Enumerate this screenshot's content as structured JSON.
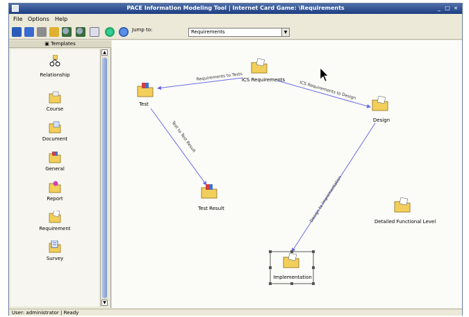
{
  "window": {
    "title": "PACE Information Modeling Tool | Internet Card Game: \\Requirements",
    "controls": [
      "_",
      "□",
      "×"
    ]
  },
  "menu": [
    "File",
    "Options",
    "Help"
  ],
  "toolbar": {
    "jump_label": "Jump to:",
    "jump_value": "Requirements",
    "icons": [
      "save-icon",
      "save-all-icon",
      "print-icon",
      "open-folder-icon",
      "zoom-in-icon",
      "zoom-out-icon",
      "grid-icon",
      "refresh-icon",
      "info-icon"
    ]
  },
  "templates": {
    "header": "Templates",
    "items": [
      {
        "label": "Relationship",
        "icon": "relationship-icon"
      },
      {
        "label": "Course",
        "icon": "course-icon"
      },
      {
        "label": "Document",
        "icon": "document-icon"
      },
      {
        "label": "General",
        "icon": "general-icon"
      },
      {
        "label": "Report",
        "icon": "report-icon"
      },
      {
        "label": "Requirement",
        "icon": "requirement-icon"
      },
      {
        "label": "Survey",
        "icon": "survey-icon"
      }
    ]
  },
  "canvas": {
    "nodes": [
      {
        "id": "ics",
        "label": "ICS Requirements"
      },
      {
        "id": "test",
        "label": "Test"
      },
      {
        "id": "design",
        "label": "Design"
      },
      {
        "id": "result",
        "label": "Test Result"
      },
      {
        "id": "detailed",
        "label": "Detailed Functional Level"
      },
      {
        "id": "impl",
        "label": "Implementation"
      }
    ],
    "edges": [
      {
        "label": "Requirements to Tests"
      },
      {
        "label": "ICS Requirements to Design"
      },
      {
        "label": "Test to Test Result"
      },
      {
        "label": "Design to Implementation"
      }
    ]
  },
  "status": "User: administrator | Ready",
  "colors": {
    "title_bar": "#1c3d82",
    "edge": "#6a6ae8",
    "folder": "#f2cf5b"
  }
}
